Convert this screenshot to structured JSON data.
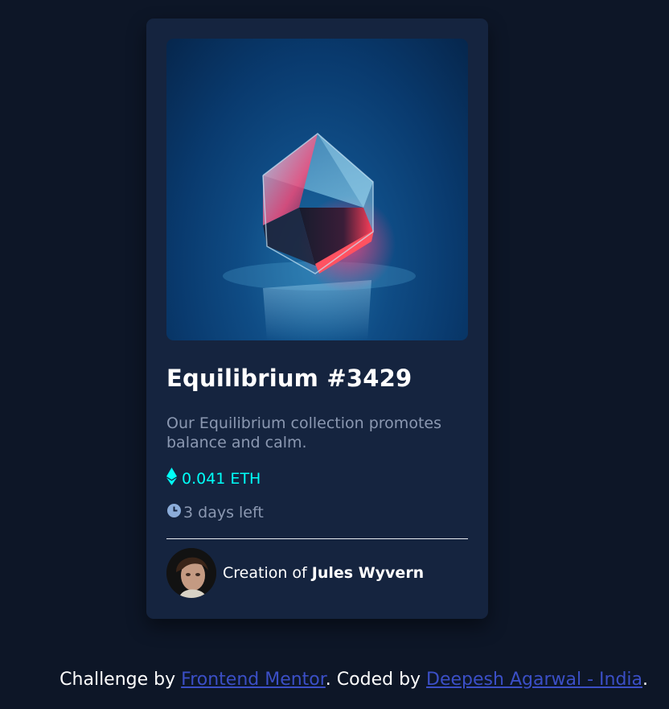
{
  "card": {
    "title": "Equilibrium #3429",
    "description": "Our Equilibrium collection promotes balance and calm.",
    "price": "0.041 ETH",
    "time_left": "3 days left",
    "creator_prefix": "Creation of ",
    "creator_name": "Jules Wyvern",
    "icons": {
      "price": "ethereum-icon",
      "time": "clock-icon"
    }
  },
  "footer": {
    "challenge_prefix": "Challenge by ",
    "challenge_link": "Frontend Mentor",
    "coded_prefix": ". Coded by ",
    "coded_link": "Deepesh Agarwal - India",
    "suffix": "."
  },
  "colors": {
    "background": "#0d1627",
    "card": "#15243f",
    "accent_cyan": "#00fff8",
    "muted_text": "#8b98b1",
    "link": "#3b4fc6"
  }
}
